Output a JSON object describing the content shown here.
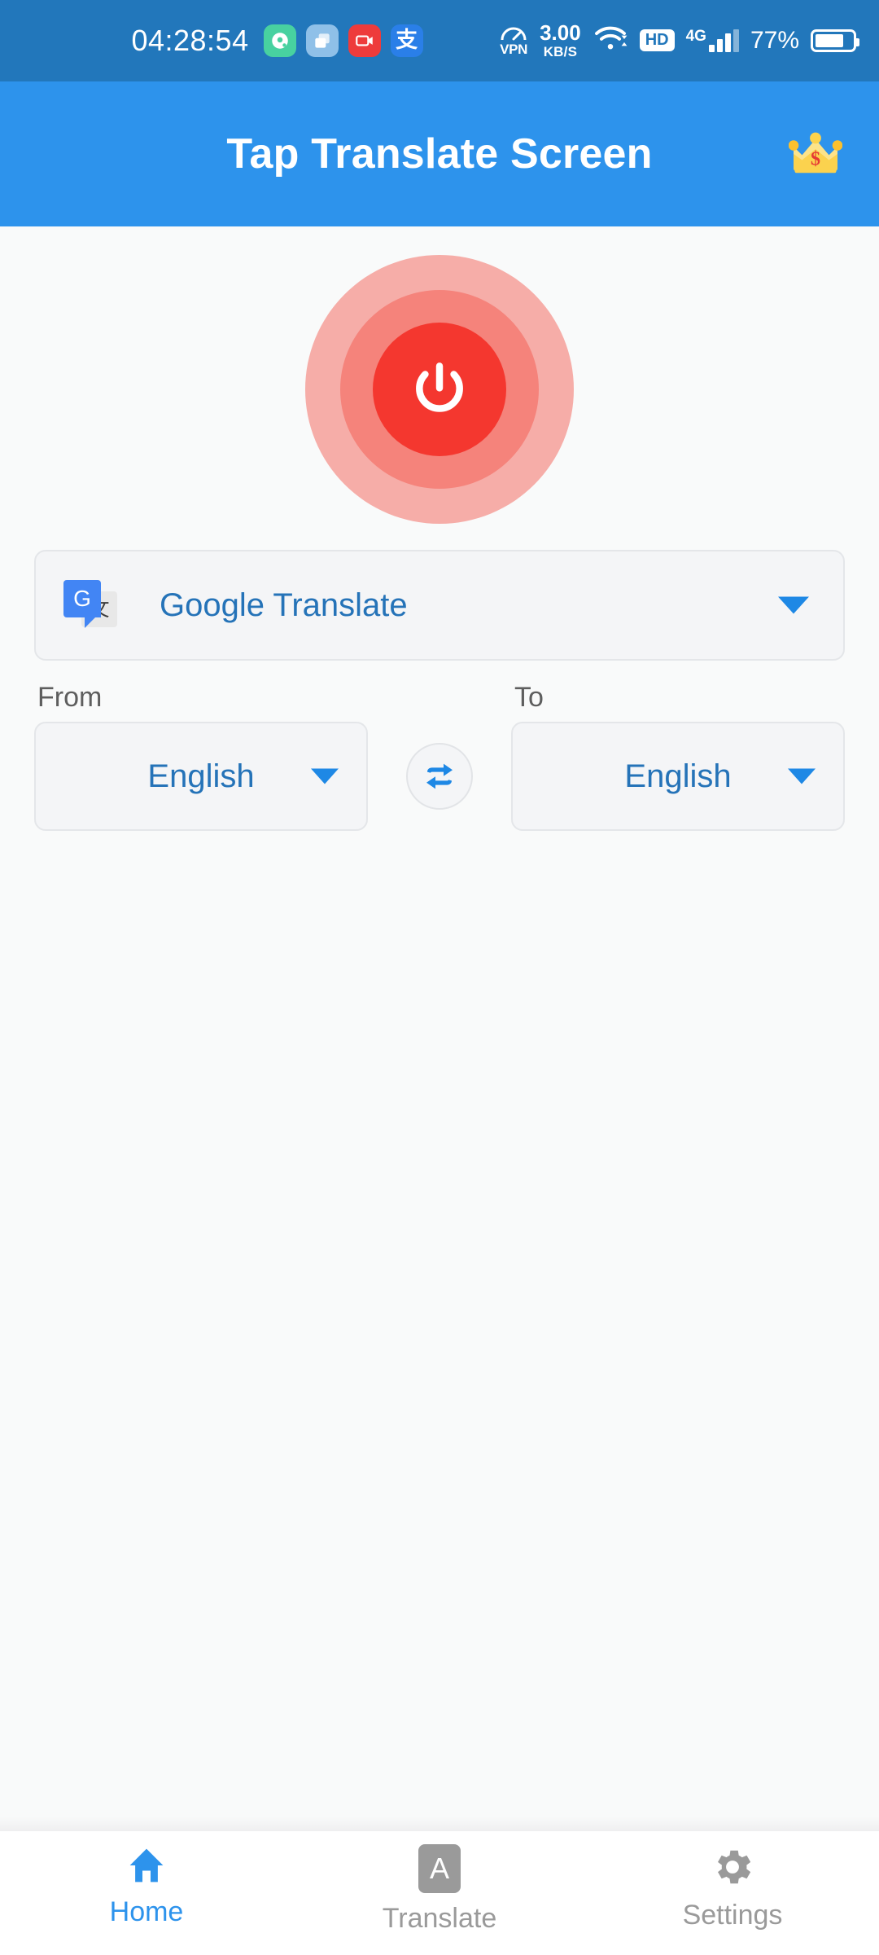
{
  "status_bar": {
    "clock": "04:28:54",
    "notifications": [
      {
        "name": "music-recorder-icon",
        "glyph": "◉"
      },
      {
        "name": "files-copy-icon",
        "glyph": "❐"
      },
      {
        "name": "screen-recorder-icon",
        "glyph": "▷"
      },
      {
        "name": "alipay-icon",
        "glyph": "支"
      }
    ],
    "vpn_label": "VPN",
    "network_speed_value": "3.00",
    "network_speed_unit": "KB/S",
    "wifi_icon": "wifi-icon",
    "hd_badge": "HD",
    "network_type": "4G",
    "battery_percent": "77%",
    "battery_level": 77,
    "background_color": "#2277BB"
  },
  "app_bar": {
    "title": "Tap Translate Screen",
    "premium_icon": "crown-icon",
    "background_color": "#2D93EC"
  },
  "main": {
    "power_button": {
      "name": "power-toggle-button",
      "state": "off",
      "color": "#F4372F"
    },
    "translator_select": {
      "label": "Google Translate",
      "icon": "google-translate-icon",
      "icon_letter": "G",
      "icon_glyph": "文",
      "caret": "chevron-down-icon"
    },
    "from": {
      "label": "From",
      "value": "English",
      "caret": "chevron-down-icon"
    },
    "swap": {
      "name": "swap-languages-button",
      "icon": "swap-arrows-icon"
    },
    "to": {
      "label": "To",
      "value": "English",
      "caret": "chevron-down-icon"
    }
  },
  "bottom_nav": {
    "items": [
      {
        "label": "Home",
        "icon": "home-icon",
        "active": true
      },
      {
        "label": "Translate",
        "icon": "translate-a-icon",
        "active": false
      },
      {
        "label": "Settings",
        "icon": "gear-icon",
        "active": false
      }
    ],
    "active_color": "#2D93EC",
    "inactive_color": "#9A9A9A"
  }
}
